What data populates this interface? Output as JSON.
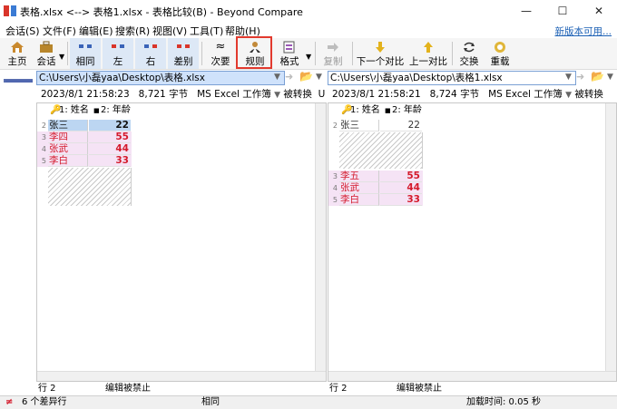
{
  "window": {
    "title": "表格.xlsx <--> 表格1.xlsx - 表格比较(B) - Beyond Compare",
    "minimize": "—",
    "maximize": "☐",
    "close": "✕"
  },
  "menu": {
    "items": [
      "会话(S)",
      "文件(F)",
      "编辑(E)",
      "搜索(R)",
      "视图(V)",
      "工具(T)",
      "帮助(H)"
    ],
    "new_version": "新版本可用..."
  },
  "toolbar": {
    "home": "主页",
    "session": "会话",
    "all": "相同",
    "left": "左",
    "right": "右",
    "diffs": "差别",
    "minor": "次要",
    "rules": "规则",
    "format": "格式",
    "copy": "复制",
    "next_diff": "下一个对比",
    "prev_diff": "上一对比",
    "swap": "交换",
    "reload": "重载",
    "minor_symbol": "≈"
  },
  "left": {
    "path": "C:\\Users\\小磊yaa\\Desktop\\表格.xlsx",
    "info_date": "2023/8/1 21:58:23",
    "info_size": "8,721 字节",
    "info_format": "MS Excel 工作簿",
    "info_state": "被转换",
    "info_extra": "U",
    "col1": "1: 姓名",
    "col2": "2: 年龄",
    "row_numbers": [
      "2",
      "3",
      "4",
      "5"
    ],
    "rows": [
      {
        "name": "张三",
        "age": "22"
      },
      {
        "name": "李四",
        "age": "55"
      },
      {
        "name": "张武",
        "age": "44"
      },
      {
        "name": "李白",
        "age": "33"
      }
    ],
    "status_row": "行 2",
    "status_edit": "编辑被禁止"
  },
  "right": {
    "path": "C:\\Users\\小磊yaa\\Desktop\\表格1.xlsx",
    "info_date": "2023/8/1 21:58:21",
    "info_size": "8,724 字节",
    "info_format": "MS Excel 工作簿",
    "info_state": "被转换",
    "col1": "1: 姓名",
    "col2": "2: 年龄",
    "row_numbers": [
      "2",
      "3",
      "4",
      "5"
    ],
    "rows": [
      {
        "name": "张三",
        "age": "22"
      },
      {
        "name": "李五",
        "age": "55"
      },
      {
        "name": "张武",
        "age": "44"
      },
      {
        "name": "李白",
        "age": "33"
      }
    ],
    "status_row": "行 2",
    "status_edit": "编辑被禁止"
  },
  "status": {
    "diff_count": "6 个差异行",
    "center": "相同",
    "load_time": "加载时间: 0.05 秒"
  },
  "colors": {
    "diff_text": "#d41b2c",
    "diff_bg": "#f5e3f5",
    "highlight_border": "#e23a2e",
    "link": "#1a5fb4"
  }
}
